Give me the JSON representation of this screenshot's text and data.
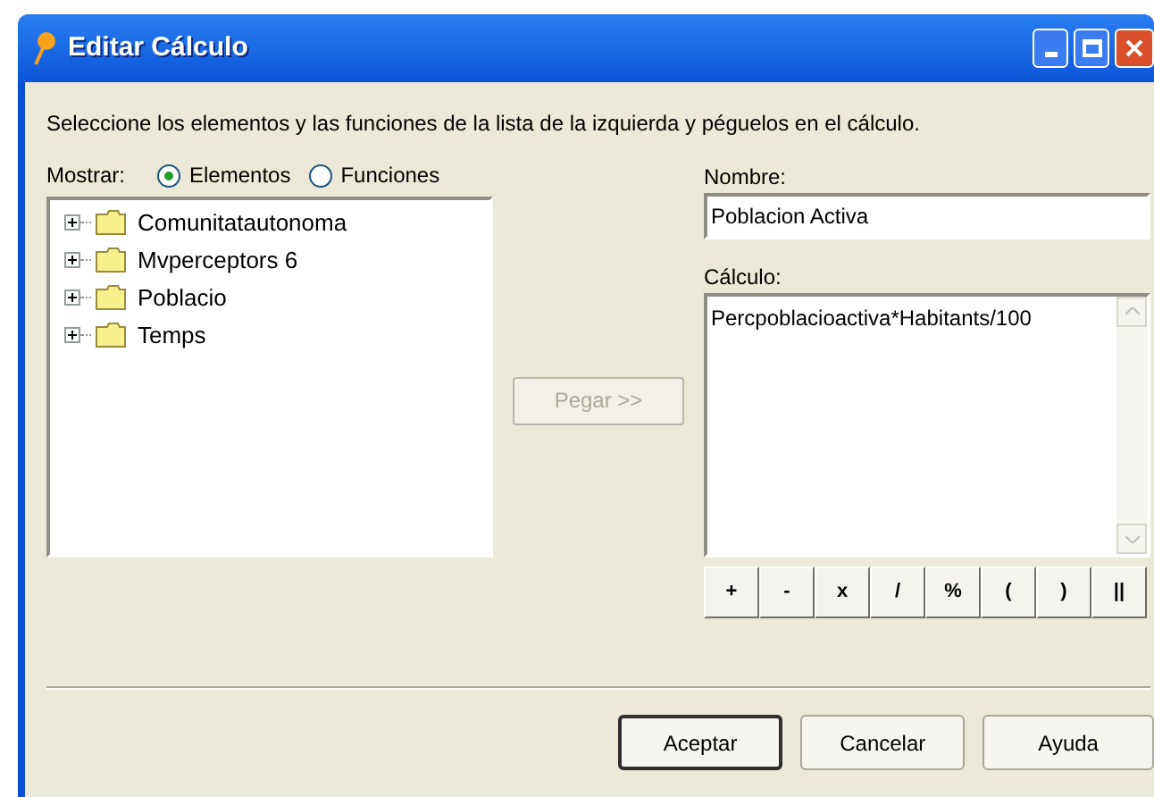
{
  "window": {
    "title": "Editar Cálculo"
  },
  "instruction": "Seleccione los elementos y las funciones de la lista de la izquierda y péguelos en el cálculo.",
  "show": {
    "label": "Mostrar:",
    "options": [
      {
        "label": "Elementos",
        "selected": true
      },
      {
        "label": "Funciones",
        "selected": false
      }
    ]
  },
  "tree": [
    {
      "label": "Comunitatautonoma",
      "expanded": false
    },
    {
      "label": "Mvperceptors 6",
      "expanded": false
    },
    {
      "label": "Poblacio",
      "expanded": false
    },
    {
      "label": "Temps",
      "expanded": false
    }
  ],
  "paste_button": {
    "label": "Pegar >>",
    "disabled": true
  },
  "name": {
    "label": "Nombre:",
    "value": "Poblacion Activa"
  },
  "calculation": {
    "label": "Cálculo:",
    "value": "Percpoblacioactiva*Habitants/100"
  },
  "operators": [
    "+",
    "-",
    "x",
    "/",
    "%",
    "(",
    ")",
    "||"
  ],
  "buttons": [
    {
      "label": "Aceptar",
      "default": true
    },
    {
      "label": "Cancelar",
      "default": false
    },
    {
      "label": "Ayuda",
      "default": false
    }
  ]
}
